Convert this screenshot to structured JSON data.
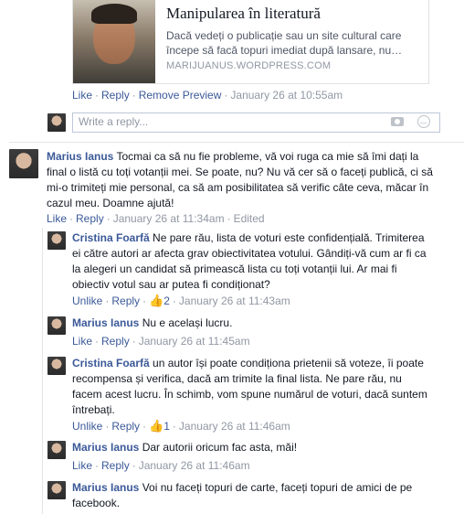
{
  "link_preview": {
    "title": "Manipularea în literatură",
    "description": "Dacă vedeți o publicație sau un site cultural care începe să facă topuri imediat după lansare, nu…",
    "domain": "MARIJUANUS.WORDPRESS.COM"
  },
  "preview_actions": {
    "like": "Like",
    "reply": "Reply",
    "remove_preview": "Remove Preview",
    "timestamp": "January 26 at 10:55am"
  },
  "reply_box": {
    "placeholder": "Write a reply..."
  },
  "comments": [
    {
      "author": "Marius Ianus",
      "text": "Tocmai ca să nu fie probleme, vă voi ruga ca mie să îmi dați la final o listă cu toți votanții mei. Se poate, nu? Nu vă cer să o faceți publică, ci să mi-o trimiteți mie personal, ca să am posibilitatea să verific câte ceva, măcar în cazul meu. Doamne ajută!",
      "like": "Like",
      "reply": "Reply",
      "timestamp": "January 26 at 11:34am",
      "edited": "Edited"
    }
  ],
  "replies": [
    {
      "author": "Cristina Foarfă",
      "text": "Ne pare rău, lista de voturi este confidențială. Trimiterea ei către autori ar afecta grav obiectivitatea votului. Gândiți-vă cum ar fi ca la alegeri un candidat să primească lista cu toți votanții lui. Ar mai fi obiectiv votul sau ar putea fi condiționat?",
      "like": "Unlike",
      "reply": "Reply",
      "likes": "2",
      "timestamp": "January 26 at 11:43am"
    },
    {
      "author": "Marius Ianus",
      "text": "Nu e același lucru.",
      "like": "Like",
      "reply": "Reply",
      "timestamp": "January 26 at 11:45am"
    },
    {
      "author": "Cristina Foarfă",
      "text": "un autor își poate condiționa prietenii să voteze, îi poate recompensa și verifica, dacă am trimite la final lista. Ne pare rău, nu facem acest lucru. În schimb, vom spune numărul de voturi, dacă suntem întrebați.",
      "like": "Unlike",
      "reply": "Reply",
      "likes": "1",
      "timestamp": "January 26 at 11:46am"
    },
    {
      "author": "Marius Ianus",
      "text": "Dar autorii oricum fac asta, măi!",
      "like": "Like",
      "reply": "Reply",
      "timestamp": "January 26 at 11:46am"
    },
    {
      "author": "Marius Ianus",
      "text": "Voi nu faceți topuri de carte, faceți topuri de amici de pe facebook."
    }
  ]
}
